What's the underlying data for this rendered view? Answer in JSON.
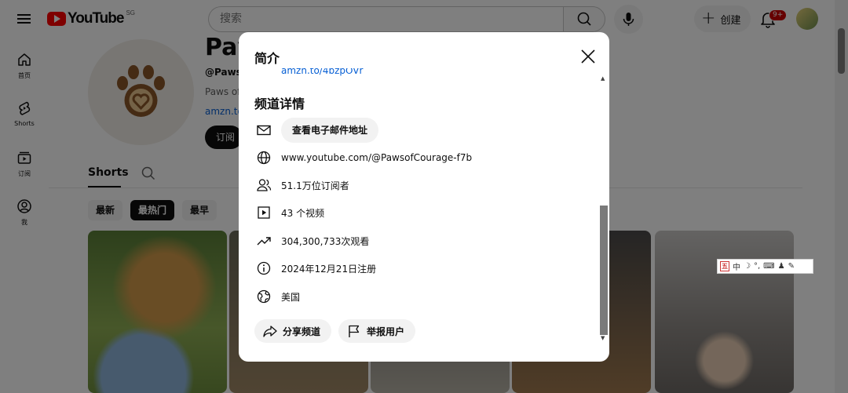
{
  "header": {
    "logo_text": "YouTube",
    "region": "SG",
    "search_placeholder": "搜索",
    "create_label": "创建",
    "notifications_badge": "9+"
  },
  "sidebar": {
    "items": [
      {
        "label": "首页",
        "icon": "home-icon"
      },
      {
        "label": "Shorts",
        "icon": "shorts-icon"
      },
      {
        "label": "订阅",
        "icon": "subscriptions-icon"
      },
      {
        "label": "我",
        "icon": "you-icon"
      }
    ]
  },
  "channel": {
    "name": "Pav",
    "handle": "@Pawso",
    "description": "Paws of",
    "link": "amzn.to",
    "subscribe_label": "订阅",
    "tabs": {
      "active": "Shorts"
    },
    "filters": [
      {
        "label": "最新",
        "active": false
      },
      {
        "label": "最热门",
        "active": true
      },
      {
        "label": "最早",
        "active": false
      }
    ]
  },
  "modal": {
    "title": "简介",
    "truncated_link": "amzn.to/4bzpOVr",
    "details_title": "频道详情",
    "email_button": "查看电子邮件地址",
    "url": "www.youtube.com/@PawsofCourage-f7b",
    "subscribers": "51.1万位订阅者",
    "videos": "43 个视频",
    "views": "304,300,733次观看",
    "joined": "2024年12月21日注册",
    "country": "美国",
    "share_label": "分享频道",
    "report_label": "举报用户"
  },
  "ime": {
    "mode": "中",
    "punct": "°,"
  }
}
